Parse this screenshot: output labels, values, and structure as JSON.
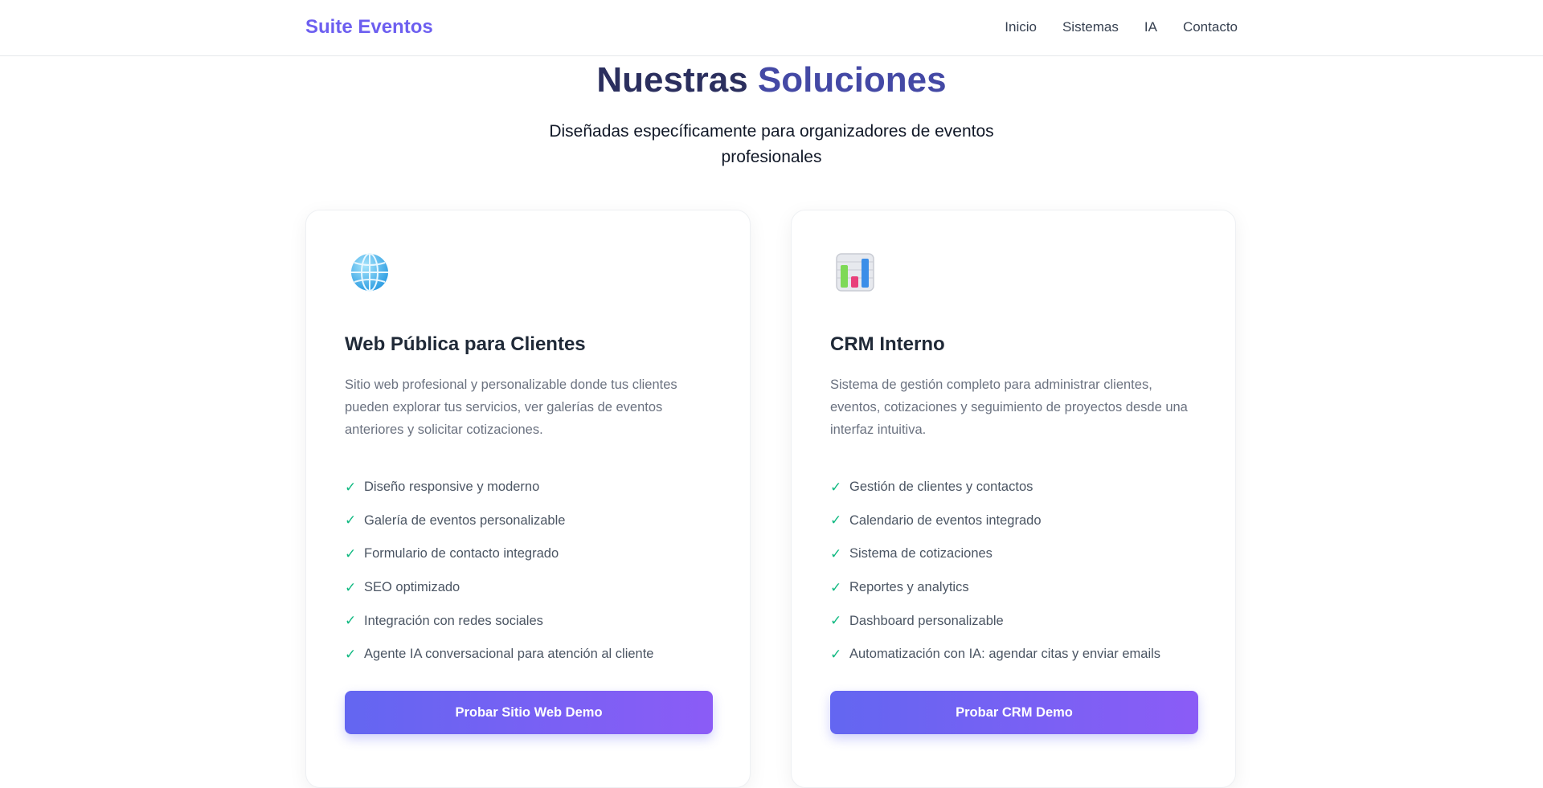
{
  "nav": {
    "brand": "Suite Eventos",
    "links": [
      "Inicio",
      "Sistemas",
      "IA",
      "Contacto"
    ]
  },
  "hero": {
    "title_part1": "Nuestras",
    "title_part2": "Soluciones",
    "subtitle": "Diseñadas específicamente para organizadores de eventos profesionales"
  },
  "cards": [
    {
      "icon": "globe-icon",
      "title": "Web Pública para Clientes",
      "description": "Sitio web profesional y personalizable donde tus clientes pueden explorar tus servicios, ver galerías de eventos anteriores y solicitar cotizaciones.",
      "features": [
        "Diseño responsive y moderno",
        "Galería de eventos personalizable",
        "Formulario de contacto integrado",
        "SEO optimizado",
        "Integración con redes sociales",
        "Agente IA conversacional para atención al cliente"
      ],
      "button": "Probar Sitio Web Demo"
    },
    {
      "icon": "bar-chart-icon",
      "title": "CRM Interno",
      "description": "Sistema de gestión completo para administrar clientes, eventos, cotizaciones y seguimiento de proyectos desde una interfaz intuitiva.",
      "features": [
        "Gestión de clientes y contactos",
        "Calendario de eventos integrado",
        "Sistema de cotizaciones",
        "Reportes y analytics",
        "Dashboard personalizable",
        "Automatización con IA: agendar citas y enviar emails"
      ],
      "button": "Probar CRM Demo"
    }
  ],
  "check_symbol": "✓",
  "colors": {
    "brand": "#6d5ff0",
    "check": "#10b981",
    "button_start": "#6366f1",
    "button_end": "#8b5cf6"
  }
}
